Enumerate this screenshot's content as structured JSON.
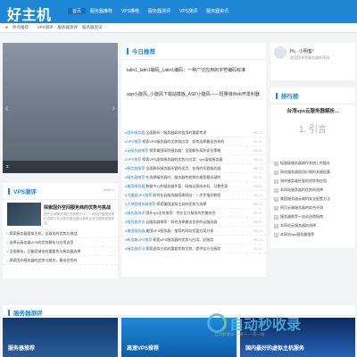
{
  "header": {
    "logo": "好主机",
    "nav": [
      "首页",
      "服务器推荐",
      "VPS推荐",
      "服务器测评",
      "VPS测评",
      "服务器资讯"
    ]
  },
  "breadcrumb": {
    "label": "热点推荐：",
    "items": [
      "VPS测评",
      "服务器测评",
      "服务器资讯"
    ]
  },
  "slider": {
    "caption": "3",
    "prev": "‹",
    "next": "›"
  },
  "featured": {
    "title": "今日推荐",
    "headline1": "latin1_latin1编码_Latin1编码：一种广泛应用的字符编码标准",
    "sub1": "",
    "headline2": "asp小旋风_小旋风下载站模板_ASP小旋风——轻量级Web开发利器",
    "sub2": ""
  },
  "news_list": [
    {
      "tag": "#国外服务器",
      "text": "全面解析：服务器如何租用的重要考虑",
      "date": "09-21"
    },
    {
      "tag": "#VPS推荐",
      "text": "探索VPS服务器的优势和应用：如何选择最适合你的",
      "date": "09-21"
    },
    {
      "tag": "#云服务器推荐",
      "text": "探索美国高防服务器：全面解析高防安全策略",
      "date": "09-21"
    },
    {
      "tag": "#VPS推荐",
      "text": "探索VPS虚拟服务器的优势与应用：vps虚拟服务器",
      "date": "09-21"
    },
    {
      "tag": "#服务器推荐",
      "text": "全面解析服务器托管的优点、在线的托管服务器",
      "date": "09-21"
    },
    {
      "tag": "#服务器推荐",
      "text": "在选择服务器时，服务器性能和价格是最关键的",
      "date": "09-21"
    },
    {
      "tag": "#美国服务器",
      "text": "数据中心的服务器托管，网络运营成本低、可靠性高",
      "date": "09-21"
    },
    {
      "tag": "#大硬盘VPS推荐",
      "text": "如何在云服务器搭建网站：一步步指导教程",
      "date": "09-21"
    },
    {
      "tag": "#大带宽服务器推荐",
      "text": "探索美国虚拟主机的优势与选择",
      "date": "09-21"
    },
    {
      "tag": "#服务器测评",
      "text": "国外vps主机推荐：性价比与服务的完美结合",
      "date": "09-21"
    },
    {
      "tag": "#服务器资讯",
      "text": "云服务器推荐：如何选择最适合你的云服务器",
      "date": "09-21"
    },
    {
      "tag": "#美国服务器",
      "text": "美国VPS服务器：推荐的网站托管方案分享",
      "date": "09-21"
    },
    {
      "tag": "#新加坡VPS推荐",
      "text": "探索VPS服务器的优势与应用、好服务",
      "date": "09-21"
    },
    {
      "tag": "#服务器资讯",
      "text": "探索虚拟主机的重要性和优势，提供全方位服务",
      "date": "09-21"
    }
  ],
  "user": {
    "greeting": "Hi，小明客！",
    "sub": "欢迎您来到服务器推荐网"
  },
  "rank": {
    "title": "排行榜",
    "hero_title": "台湾vps云服务器解析...",
    "hero_quote": "1. 引言",
    "items": [
      {
        "n": "2",
        "text": "轻量级服务器操作系统上的缓存"
      },
      {
        "n": "3",
        "text": "网站服务器租用价格的关键因素"
      },
      {
        "n": "4",
        "text": "海外服务器托管的优势和应用"
      },
      {
        "n": "5",
        "text": "本网站服务器的优势的选择"
      },
      {
        "n": "6",
        "text": "美国服务器云端的安全配置方法"
      },
      {
        "n": "7",
        "text": "网页云端服务器的综合评测"
      },
      {
        "n": "8",
        "text": "服务器推荐一站式选购指南"
      },
      {
        "n": "9",
        "text": "本网站云服务器的选择"
      },
      {
        "n": "10",
        "text": "本网站vps服务器推荐"
      }
    ]
  },
  "vps_review": {
    "title": "VPS测评",
    "more": "More »",
    "headline": "探索国外空间服务商的优势与挑战",
    "desc": "国外空间服务商的优势是什么？，网站托管服务商的选择与在众多的网站建设者和企业中越来越受欢迎。",
    "items": [
      "探索服务器虚拟主机，全球化的优势与挑战",
      "选择云服务器VPS的优势解析与应用选型",
      "全面解析，已备案域名的重要性与服务器选择",
      "探索国外服务器的优势与服务，最适合您的"
    ]
  },
  "server_review": {
    "title": "服务器测评"
  },
  "tiles": [
    "服务器推荐",
    "高速VPS推荐",
    "国内最好的虚拟主机服务"
  ],
  "watermark": {
    "text": "自动秒收录",
    "sub": "自动秒收录 一条一 一次一站"
  }
}
